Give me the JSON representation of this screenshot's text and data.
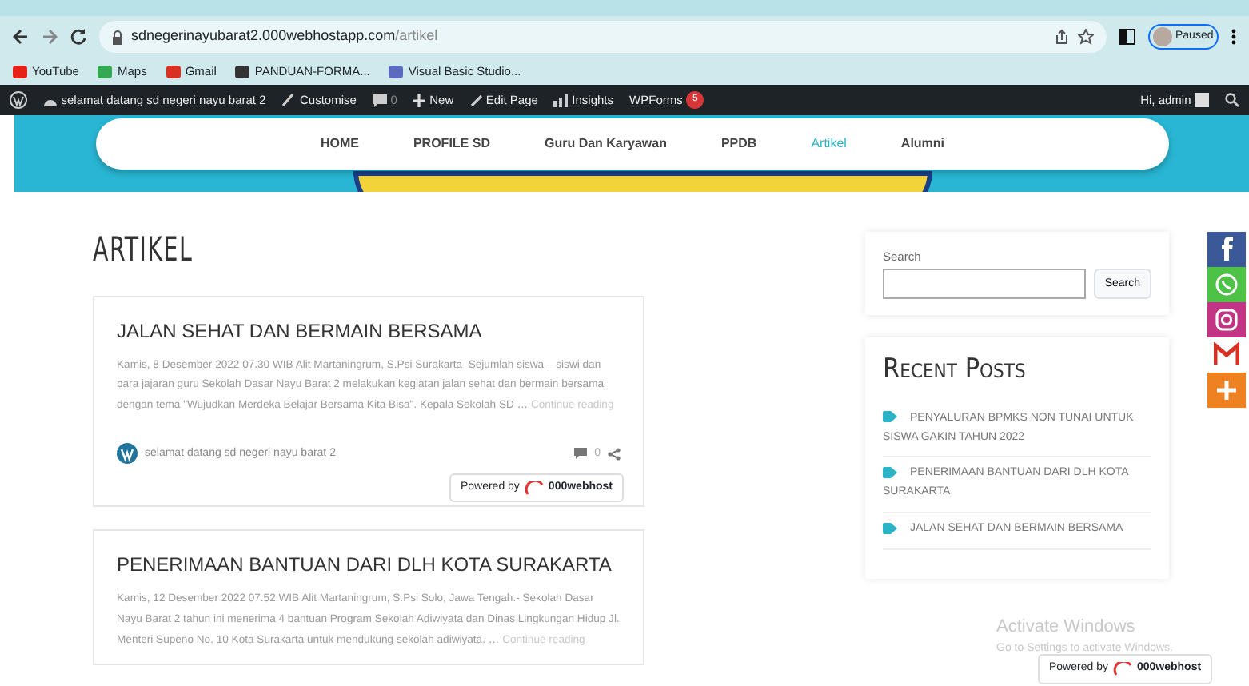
{
  "browser": {
    "url_host": "sdnegerinayubarat2.000webhostapp.com",
    "url_path": "/artikel",
    "profile": "Paused",
    "bookmarks": [
      {
        "label": "YouTube",
        "color": "#e62117"
      },
      {
        "label": "Maps",
        "color": "#34a853"
      },
      {
        "label": "Gmail",
        "color": "#d93025"
      },
      {
        "label": "PANDUAN-FORMA...",
        "color": "#333333"
      },
      {
        "label": "Visual Basic Studio...",
        "color": "#5c6bc0"
      }
    ]
  },
  "admin_bar": {
    "site": "selamat datang sd negeri nayu barat 2",
    "customise": "Customise",
    "comments": "0",
    "new": "New",
    "edit": "Edit Page",
    "insights": "Insights",
    "wpforms": "WPForms",
    "wpforms_badge": "5",
    "greeting": "Hi, admin"
  },
  "nav": [
    {
      "label": "HOME",
      "selected": false
    },
    {
      "label": "PROFILE SD",
      "selected": false
    },
    {
      "label": "Guru Dan Karyawan",
      "selected": false
    },
    {
      "label": "PPDB",
      "selected": false
    },
    {
      "label": "Artikel",
      "selected": true
    },
    {
      "label": "Alumni",
      "selected": false
    }
  ],
  "page_title": "ARTIKEL",
  "posts": [
    {
      "title": "JALAN SEHAT DAN BERMAIN BERSAMA",
      "excerpt": "Kamis, 8 Desember 2022 07.30 WIB Alit Martaningrum, S.Psi Surakarta–Sejumlah siswa – siswi dan para jajaran guru Sekolah Dasar Nayu Barat 2 melakukan kegiatan jalan sehat dan bermain bersama dengan tema \"Wujudkan Merdeka Belajar Bersama Kita Bisa\". Kepala Sekolah SD …",
      "more": "Continue reading",
      "author": "selamat datang sd negeri nayu barat 2",
      "comments": "0"
    },
    {
      "title": "PENERIMAAN BANTUAN DARI DLH KOTA SURAKARTA",
      "excerpt": "Kamis, 12 Desember 2022 07.52 WIB Alit Martaningrum, S.Psi Solo, Jawa Tengah.- Sekolah Dasar Nayu Barat 2 tahun ini menerima 4 bantuan Program Sekolah Adiwiyata dan Dinas Lingkungan Hidup Jl. Menteri Supeno No. 10 Kota Surakarta untuk mendukung sekolah adiwiyata. …",
      "more": "Continue reading"
    }
  ],
  "search": {
    "label": "Search",
    "button": "Search"
  },
  "recent_posts": {
    "title": "Recent Posts",
    "items": [
      "PENYALURAN BPMKS NON TUNAI UNTUK SISWA GAKIN TAHUN 2022",
      "PENERIMAAN BANTUAN DARI DLH KOTA SURAKARTA",
      "JALAN SEHAT DAN BERMAIN BERSAMA"
    ]
  },
  "share": [
    {
      "kind": "facebook",
      "color": "#3b5998"
    },
    {
      "kind": "whatsapp",
      "color": "#4dc247"
    },
    {
      "kind": "instagram",
      "color": "#c13584"
    },
    {
      "kind": "gmail",
      "color": "#ffffff"
    },
    {
      "kind": "more",
      "color": "#ee8121"
    }
  ],
  "powered_badges": [
    {
      "label": "Powered by",
      "brand": "000webhost"
    },
    {
      "label": "Powered by",
      "brand": "000webhost"
    }
  ],
  "os_notice": {
    "title": "Activate Windows",
    "text": "Go to Settings to activate Windows."
  }
}
